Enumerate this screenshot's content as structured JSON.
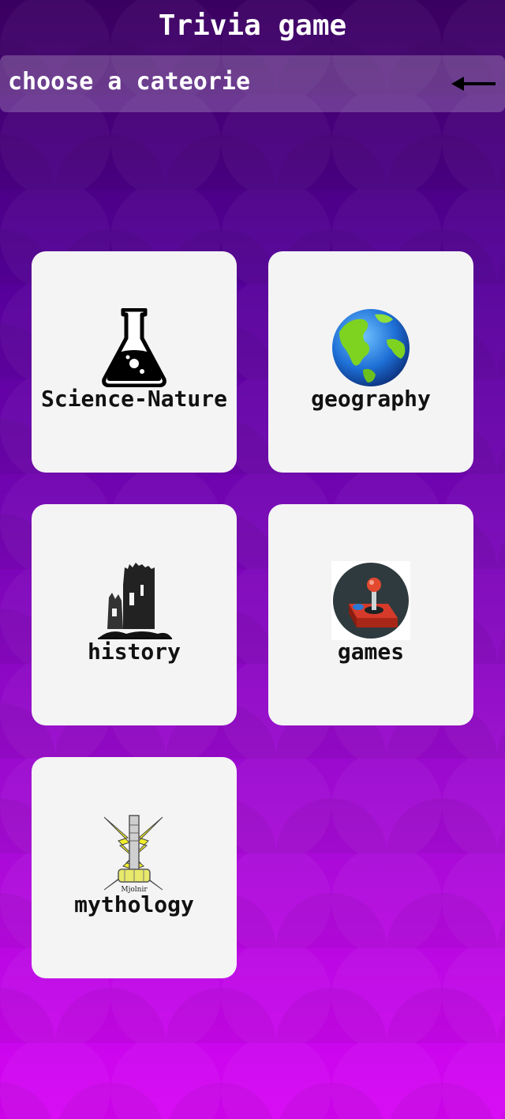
{
  "header": {
    "title": "Trivia game"
  },
  "subheader": {
    "label": "choose a cateorie",
    "back_icon": "arrow-left-icon"
  },
  "categories": [
    {
      "label": "Science-Nature",
      "icon": "flask-icon"
    },
    {
      "label": "geography",
      "icon": "globe-icon"
    },
    {
      "label": "history",
      "icon": "castle-ruin-icon"
    },
    {
      "label": "games",
      "icon": "joystick-icon"
    },
    {
      "label": "mythology",
      "icon": "mjolnir-icon",
      "icon_caption": "Mjolnir"
    }
  ],
  "colors": {
    "bg_top": "#3a0060",
    "bg_bottom": "#d704f5",
    "card": "#f4f4f4",
    "text": "#ffffff"
  }
}
